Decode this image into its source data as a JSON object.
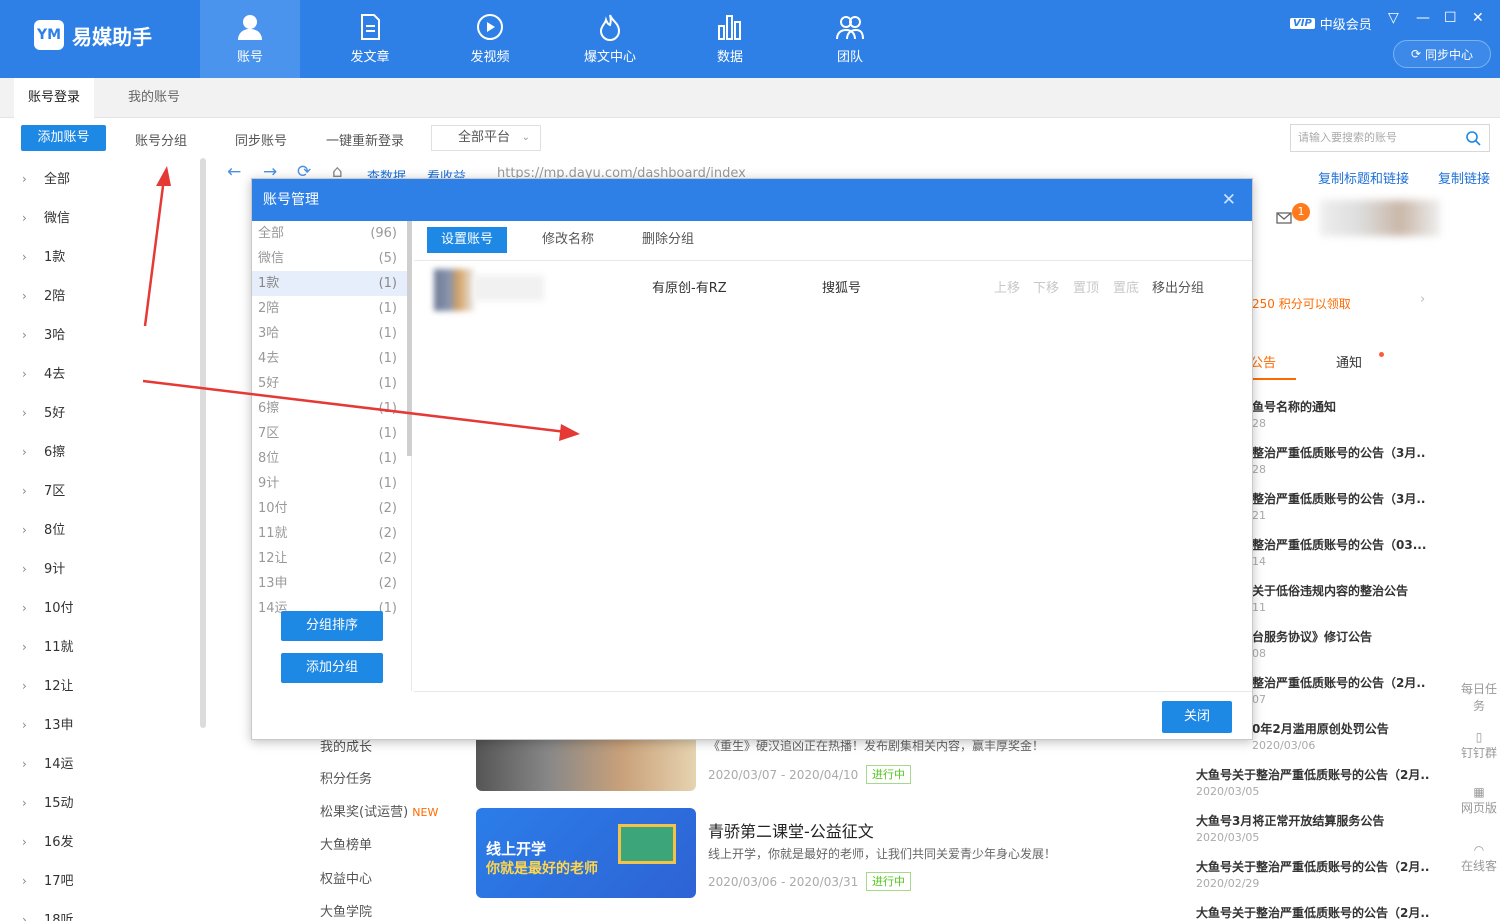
{
  "app": {
    "name": "易媒助手",
    "logo_text": "YM"
  },
  "nav": [
    {
      "label": "账号",
      "icon": "user-icon",
      "active": true
    },
    {
      "label": "发文章",
      "icon": "document-icon"
    },
    {
      "label": "发视频",
      "icon": "play-icon"
    },
    {
      "label": "爆文中心",
      "icon": "flame-icon"
    },
    {
      "label": "数据",
      "icon": "bar-chart-icon"
    },
    {
      "label": "团队",
      "icon": "team-icon"
    }
  ],
  "window": {
    "vip_badge": "VIP",
    "member_label": "中级会员",
    "sync_label": "同步中心"
  },
  "subtabs": [
    {
      "label": "账号登录",
      "active": true
    },
    {
      "label": "我的账号"
    }
  ],
  "toolbar": {
    "add_account": "添加账号",
    "account_group": "账号分组",
    "sync_account": "同步账号",
    "relogin": "一键重新登录",
    "platform_select": "全部平台",
    "search_placeholder": "请输入要搜索的账号"
  },
  "sidebar": {
    "items": [
      "全部",
      "微信",
      "1款",
      "2陪",
      "3哈",
      "4去",
      "5好",
      "6擦",
      "7区",
      "8位",
      "9计",
      "10付",
      "11就",
      "12让",
      "13申",
      "14运",
      "15动",
      "16发",
      "17吧",
      "18听"
    ]
  },
  "browser": {
    "view_data": "查数据",
    "view_income": "看收益",
    "url": "https://mp.dayu.com/dashboard/index",
    "copy_title_link": "复制标题和链接",
    "copy_link": "复制链接"
  },
  "background": {
    "badge_count": "1",
    "points_text": "250 积分可以领取",
    "tab_announce": "公告",
    "tab_notice": "通知",
    "links": [
      "我的成长",
      "积分任务",
      "松果奖(试运营)",
      "大鱼榜单",
      "权益中心",
      "大鱼学院"
    ],
    "new_tag": "NEW",
    "card1_text": "《重生》硬汉追凶正在热播！发布剧集相关内容，赢丰厚奖金！",
    "card1_date": "2020/03/07 - 2020/04/10",
    "card1_status": "进行中",
    "card2_title": "青骄第二课堂-公益征文",
    "card2_text": "线上开学，你就是最好的老师，让我们共同关爱青少年身心发展！",
    "card2_date": "2020/03/06 - 2020/03/31",
    "card2_status": "进行中",
    "card2_img_line1": "线上开学",
    "card2_img_line2": "你就是最好的老师",
    "notices": [
      {
        "title": "鱼号名称的通知",
        "date": "28"
      },
      {
        "title": "整治严重低质账号的公告（3月..",
        "date": "28"
      },
      {
        "title": "整治严重低质账号的公告（3月..",
        "date": "21"
      },
      {
        "title": "整治严重低质账号的公告（03...",
        "date": "14"
      },
      {
        "title": "关于低俗违规内容的整治公告",
        "date": "11"
      },
      {
        "title": "台服务协议》修订公告",
        "date": "08"
      },
      {
        "title": "整治严重低质账号的公告（2月..",
        "date": "07"
      },
      {
        "title": "0年2月滥用原创处罚公告",
        "date": "2020/03/06"
      },
      {
        "title": "大鱼号关于整治严重低质账号的公告（2月..",
        "date": "2020/03/05"
      },
      {
        "title": "大鱼号3月将正常开放结算服务公告",
        "date": "2020/03/05"
      },
      {
        "title": "大鱼号关于整治严重低质账号的公告（2月..",
        "date": "2020/02/29"
      },
      {
        "title": "大鱼号关于整治严重低质账号的公告（2月..",
        "date": ""
      }
    ],
    "right_float": [
      "每日任务",
      "钉钉群",
      "网页版",
      "在线客"
    ]
  },
  "modal": {
    "title": "账号管理",
    "groups": [
      {
        "name": "全部",
        "count": "(96)"
      },
      {
        "name": "微信",
        "count": "(5)"
      },
      {
        "name": "1款",
        "count": "(1)",
        "active": true
      },
      {
        "name": "2陪",
        "count": "(1)"
      },
      {
        "name": "3哈",
        "count": "(1)"
      },
      {
        "name": "4去",
        "count": "(1)"
      },
      {
        "name": "5好",
        "count": "(1)"
      },
      {
        "name": "6擦",
        "count": "(1)"
      },
      {
        "name": "7区",
        "count": "(1)"
      },
      {
        "name": "8位",
        "count": "(1)"
      },
      {
        "name": "9计",
        "count": "(1)"
      },
      {
        "name": "10付",
        "count": "(2)"
      },
      {
        "name": "11就",
        "count": "(2)"
      },
      {
        "name": "12让",
        "count": "(2)"
      },
      {
        "name": "13申",
        "count": "(2)"
      },
      {
        "name": "14运",
        "count": "(1)"
      }
    ],
    "sort_groups": "分组排序",
    "add_group": "添加分组",
    "tabs": [
      "设置账号",
      "修改名称",
      "删除分组"
    ],
    "account": {
      "name": "有原创-有RZ",
      "platform": "搜狐号",
      "move_up": "上移",
      "move_down": "下移",
      "to_top": "置顶",
      "to_bottom": "置底",
      "remove": "移出分组"
    },
    "close_label": "关闭"
  },
  "colors": {
    "brand": "#2f80e6",
    "primary_button": "#1e88e5",
    "annotation_arrow": "#e53935"
  }
}
